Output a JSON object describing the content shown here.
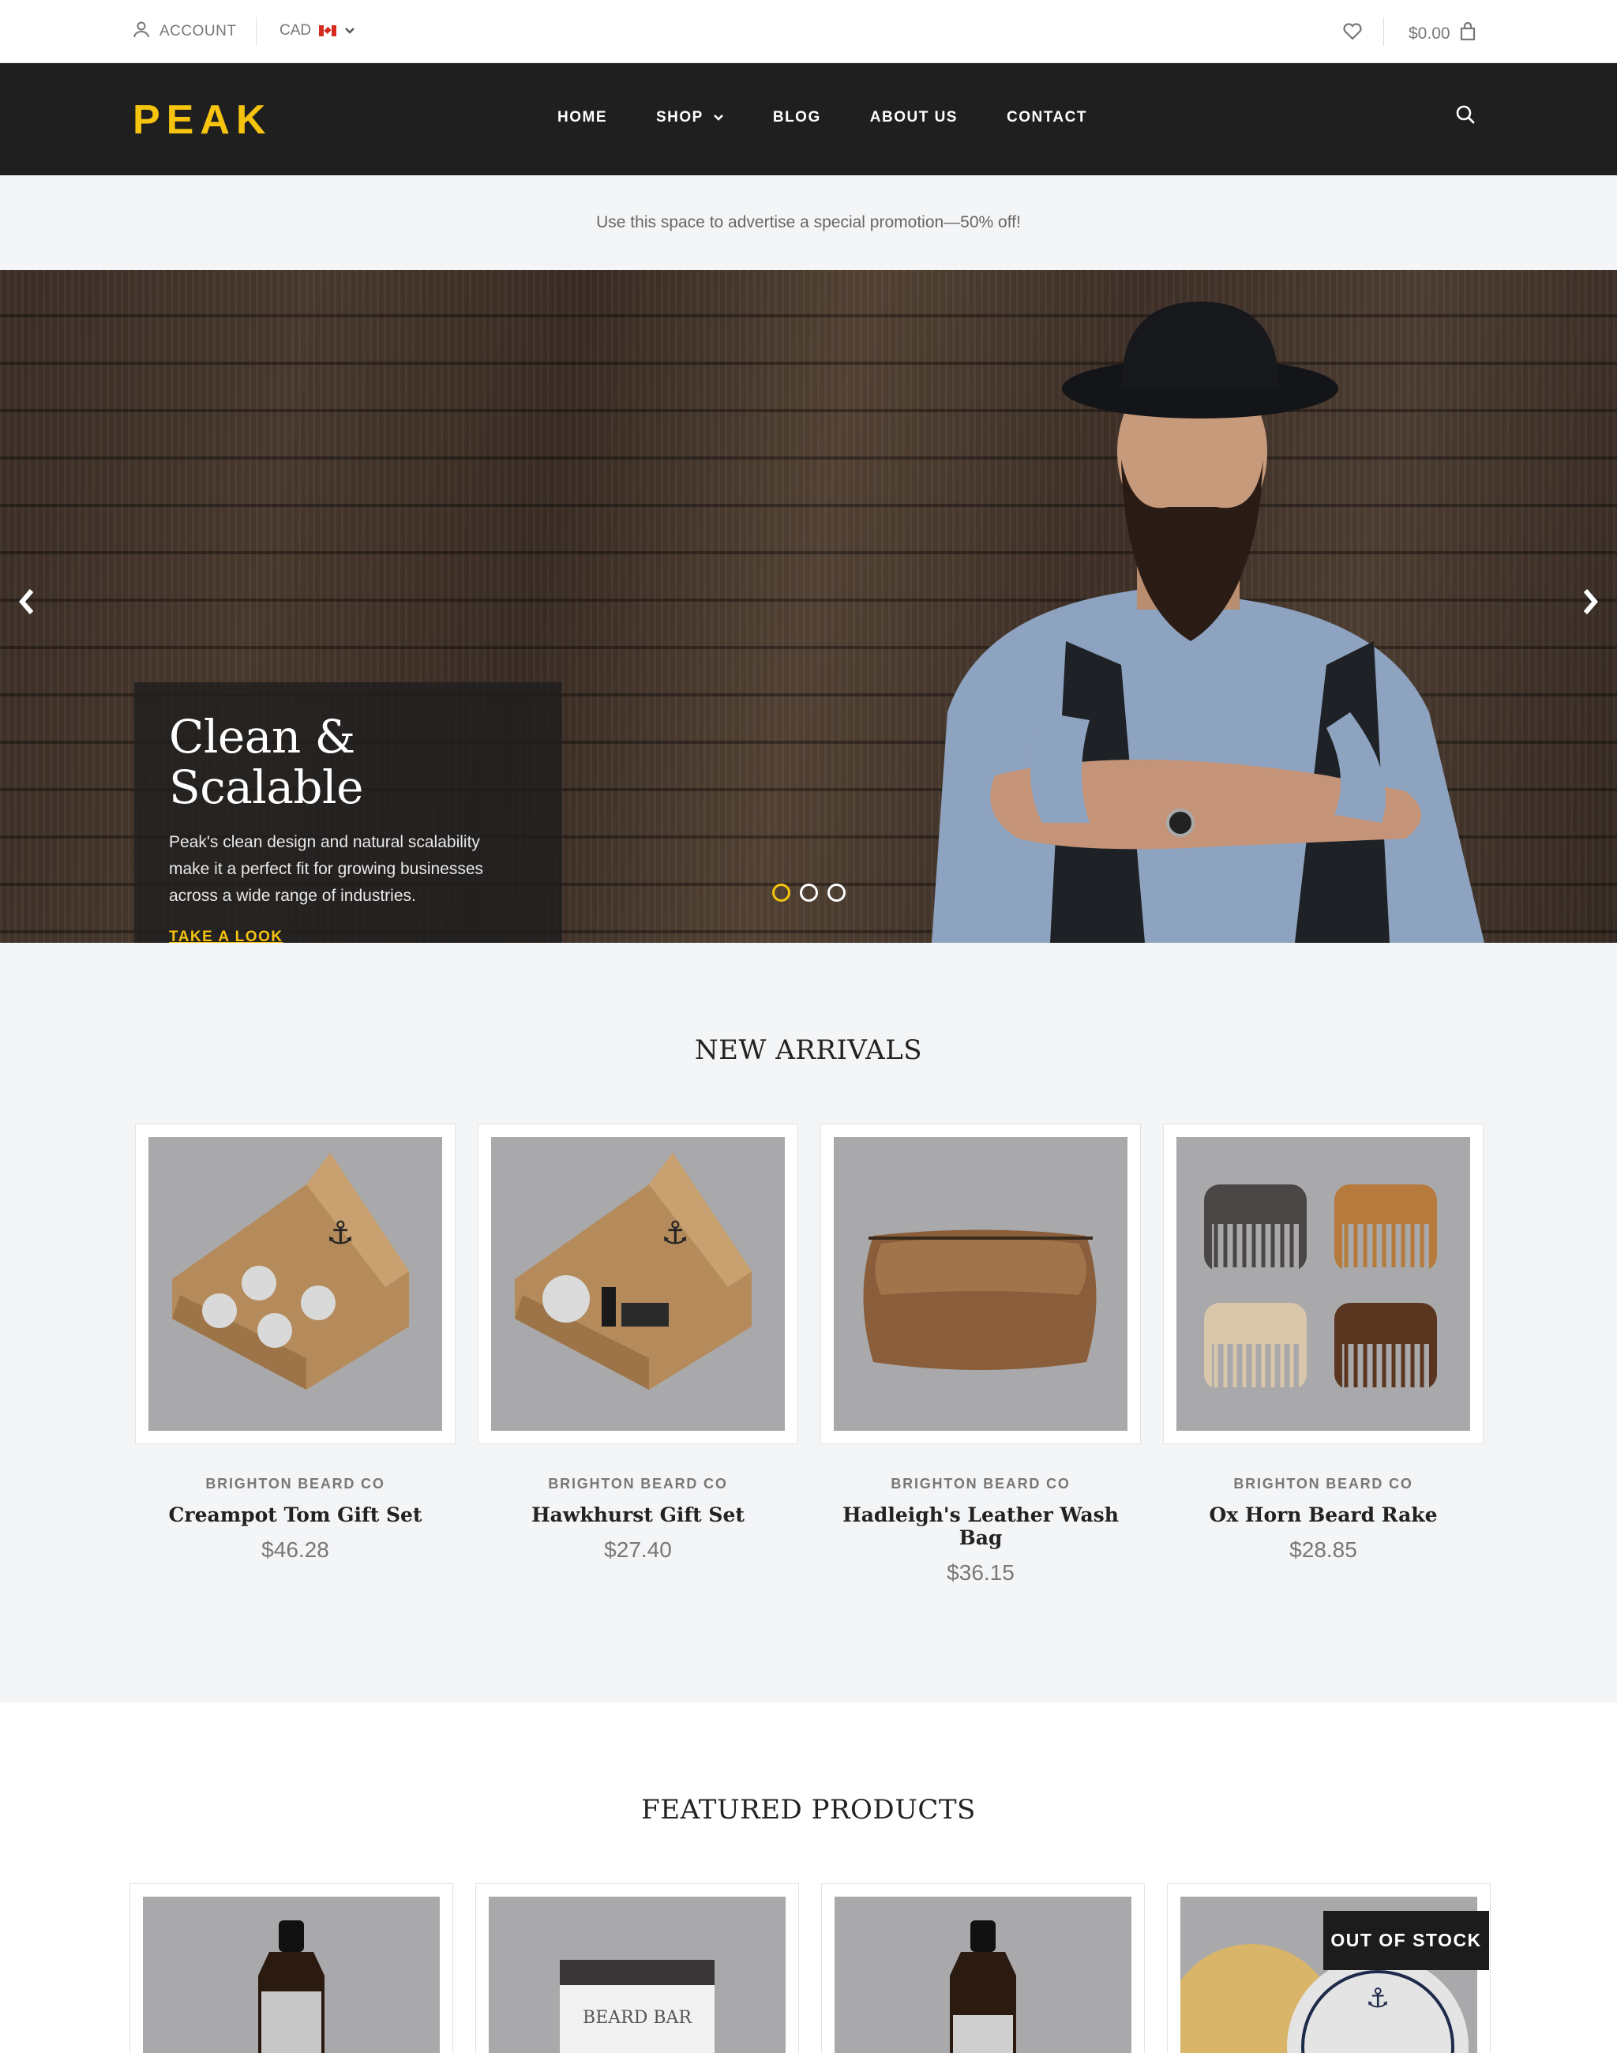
{
  "utility": {
    "account_label": "ACCOUNT",
    "currency_label": "CAD",
    "cart_total": "$0.00"
  },
  "nav": {
    "logo": "PEAK",
    "items": [
      {
        "label": "HOME"
      },
      {
        "label": "SHOP"
      },
      {
        "label": "BLOG"
      },
      {
        "label": "ABOUT US"
      },
      {
        "label": "CONTACT"
      }
    ]
  },
  "promo": {
    "text": "Use this space to advertise a special promotion—50% off!"
  },
  "hero": {
    "title": "Clean & Scalable",
    "body": "Peak's clean design and natural scalability make it a perfect fit for growing businesses across a wide range of industries.",
    "link": "TAKE A LOOK",
    "slides_total": 3,
    "active_slide": 1
  },
  "new_arrivals": {
    "title": "NEW ARRIVALS",
    "products": [
      {
        "vendor": "BRIGHTON BEARD CO",
        "name": "Creampot Tom Gift Set",
        "price": "$46.28"
      },
      {
        "vendor": "BRIGHTON BEARD CO",
        "name": "Hawkhurst Gift Set",
        "price": "$27.40"
      },
      {
        "vendor": "BRIGHTON BEARD CO",
        "name": "Hadleigh's Leather Wash Bag",
        "price": "$36.15"
      },
      {
        "vendor": "BRIGHTON BEARD CO",
        "name": "Ox Horn Beard Rake",
        "price": "$28.85"
      }
    ]
  },
  "featured": {
    "title": "FEATURED PRODUCTS",
    "badge": "OUT OF STOCK"
  },
  "colors": {
    "accent": "#f6c40e",
    "nav_bg": "#1f1f1f",
    "page_bg": "#f4f5f7"
  }
}
